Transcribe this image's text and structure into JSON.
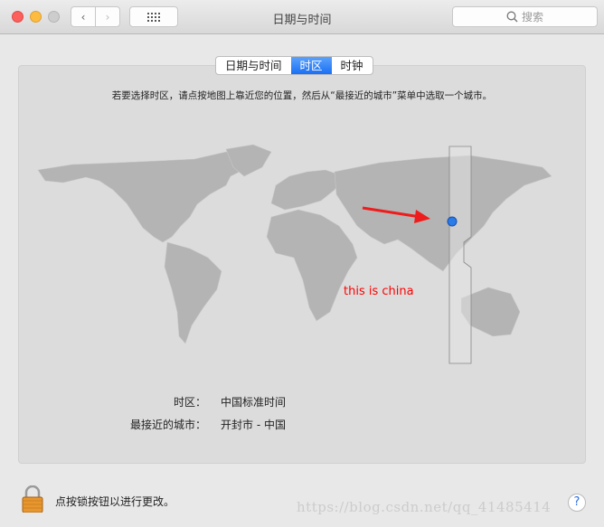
{
  "window": {
    "title": "日期与时间",
    "search_placeholder": "搜索"
  },
  "tabs": [
    {
      "label": "日期与时间"
    },
    {
      "label": "时区",
      "active": true
    },
    {
      "label": "时钟"
    }
  ],
  "instruction": "若要选择时区，请点按地图上靠近您的位置，然后从“最接近的城市”菜单中选取一个城市。",
  "annotation": {
    "text": "this is china",
    "color": "#ff0000"
  },
  "fields": {
    "timezone_label": "时区：",
    "timezone_value": "中国标准时间",
    "city_label": "最接近的城市：",
    "city_value": "开封市 - 中国"
  },
  "footer": {
    "lock_text": "点按锁按钮以进行更改。",
    "help": "?"
  },
  "watermark": "https://blog.csdn.net/qq_41485414",
  "colors": {
    "accent": "#1a6ff5",
    "close": "#fc605c",
    "minimize": "#fdbc40",
    "map_land": "#b4b4b4"
  }
}
